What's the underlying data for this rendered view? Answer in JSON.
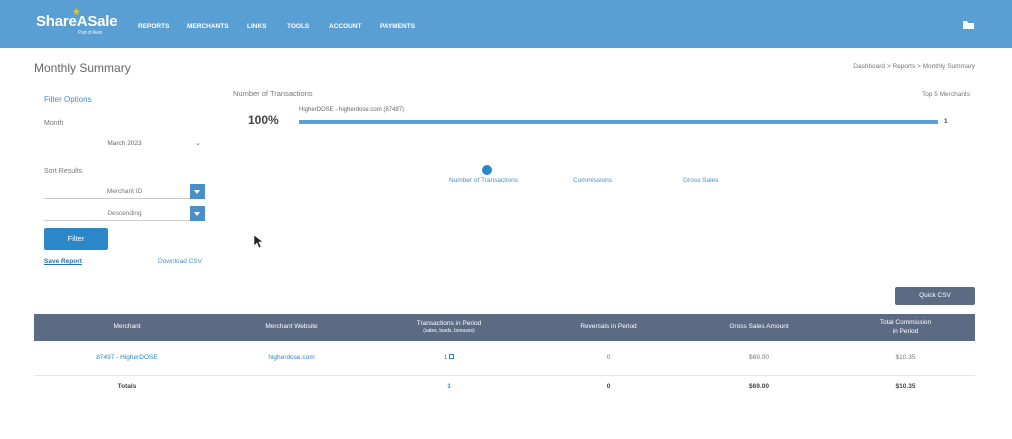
{
  "header": {
    "logo": "ShareASale",
    "logo_sub": "Part of Awin",
    "nav": [
      "REPORTS",
      "MERCHANTS",
      "LINKS",
      "TOOLS",
      "ACCOUNT",
      "PAYMENTS"
    ],
    "accent_color": "#5a9fd4"
  },
  "page": {
    "title": "Monthly Summary",
    "breadcrumb": "Dashboard > Reports > Monthly Summary"
  },
  "filters": {
    "title": "Filter Options",
    "month_label": "Month",
    "month_value": "March 2023",
    "sort_label": "Sort Results",
    "sort_by": "Merchant ID",
    "sort_order": "Descending",
    "filter_button": "Filter",
    "save_report": "Save Report",
    "download_csv": "Download CSV"
  },
  "chart": {
    "title": "Number of Transactions",
    "top_label": "Top 5 Merchants",
    "bar_label": "HigherDOSE - higherdose.com (87497)",
    "bar_percent": "100%",
    "bar_fraction": 1.0,
    "bar_count": "1",
    "metrics": [
      "Number of Transactions",
      "Commissions",
      "Gross Sales"
    ],
    "active_metric": 0
  },
  "quick_csv": "Quick CSV",
  "table": {
    "headers": [
      {
        "label": "Merchant",
        "sub": ""
      },
      {
        "label": "Merchant Website",
        "sub": ""
      },
      {
        "label": "Transactions in Period",
        "sub": "(sales, leads, bonuses)"
      },
      {
        "label": "Reversals in Period",
        "sub": ""
      },
      {
        "label": "Gross Sales Amount",
        "sub": ""
      },
      {
        "label": "Total Commission",
        "sub": "in Period"
      }
    ],
    "rows": [
      {
        "merchant": "87497 - HigherDOSE",
        "website": "higherdose.com",
        "transactions": "1",
        "reversals": "0",
        "gross": "$69.00",
        "commission": "$10.35"
      }
    ],
    "totals": {
      "label": "Totals",
      "transactions": "1",
      "reversals": "0",
      "gross": "$69.00",
      "commission": "$10.35"
    }
  }
}
